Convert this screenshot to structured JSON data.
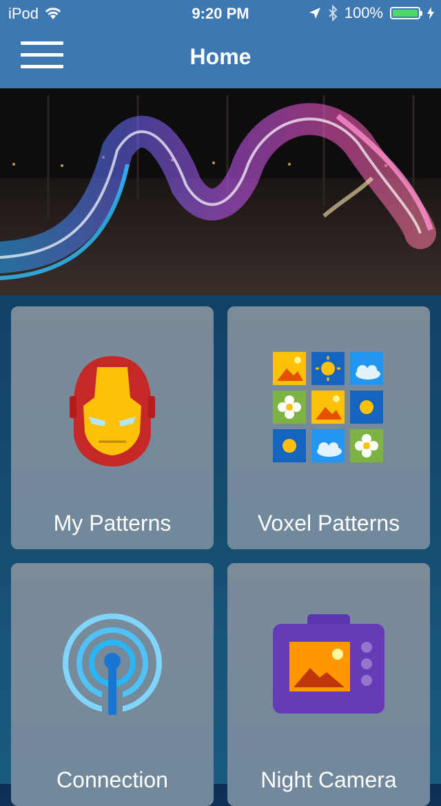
{
  "status_bar": {
    "carrier": "iPod",
    "time": "9:20 PM",
    "battery": "100%"
  },
  "nav": {
    "title": "Home",
    "menu_icon": "hamburger-menu-icon"
  },
  "hero": {
    "image": "light-painting-photo"
  },
  "tiles": [
    {
      "label": "My Patterns",
      "icon": "iron-man-mask-icon"
    },
    {
      "label": "Voxel Patterns",
      "icon": "image-grid-icon"
    },
    {
      "label": "Connection",
      "icon": "broadcast-antenna-icon"
    },
    {
      "label": "Night Camera",
      "icon": "camera-icon"
    }
  ],
  "colors": {
    "nav_bar": "#3d78b2",
    "tile": "#768a9c",
    "battery": "#4cd964"
  }
}
